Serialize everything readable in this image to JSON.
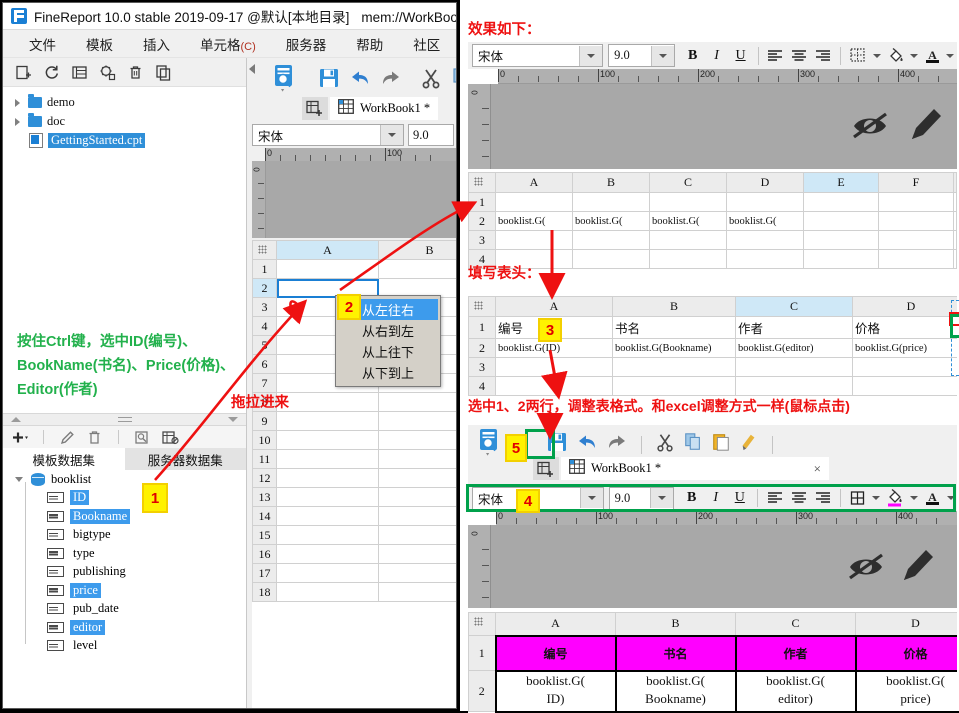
{
  "window": {
    "title": "FineReport 10.0 stable 2019-09-17 @默认[本地目录]",
    "title2": "mem://WorkBoo",
    "logo_icon": "finereport-logo-icon"
  },
  "menu": {
    "items": [
      {
        "label": "文件"
      },
      {
        "label": "模板"
      },
      {
        "label": "插入"
      },
      {
        "label": "单元格",
        "accel": "(C)"
      },
      {
        "label": "服务器"
      },
      {
        "label": "帮助"
      },
      {
        "label": "社区"
      }
    ]
  },
  "tree_toolbar": {
    "icons": [
      "new-template-icon",
      "refresh-icon",
      "rename-icon",
      "settings-icon",
      "delete-icon",
      "copy-icon"
    ]
  },
  "file_tree": {
    "items": [
      {
        "label": "demo",
        "type": "folder"
      },
      {
        "label": "doc",
        "type": "folder"
      },
      {
        "label": "GettingStarted.cpt",
        "type": "file",
        "selected": true
      }
    ]
  },
  "annotations": {
    "green_note_1": [
      "按住Ctrl键，选中ID(编号)、",
      "BookName(书名)、Price(价格)、",
      "Editor(作者)"
    ],
    "drag_in": "拖拉进来",
    "effect_title": "效果如下：",
    "fill_header_title": "填写表头：",
    "adjust_rows": "选中1、2两行，调整表格式。和excel调整方式一样(鼠标点击)"
  },
  "dataset_toolbar": {
    "icons": [
      "add-icon",
      "edit-icon",
      "delete-icon",
      "preview-icon",
      "dataset-config-icon"
    ]
  },
  "dataset_tabs": [
    {
      "label": "模板数据集",
      "active": true
    },
    {
      "label": "服务器数据集",
      "active": false
    }
  ],
  "dataset_tree": {
    "root": "booklist",
    "fields": [
      {
        "label": "ID",
        "selected": true
      },
      {
        "label": "Bookname",
        "selected": true
      },
      {
        "label": "bigtype",
        "selected": false
      },
      {
        "label": "type",
        "selected": false
      },
      {
        "label": "publishing",
        "selected": false
      },
      {
        "label": "price",
        "selected": true
      },
      {
        "label": "pub_date",
        "selected": false
      },
      {
        "label": "editor",
        "selected": true
      },
      {
        "label": "level",
        "selected": false
      }
    ]
  },
  "workbook": {
    "tab_label": "WorkBook1 *",
    "close_label": "×",
    "toolbar_icons": [
      "template-preview-icon",
      "save-icon",
      "undo-icon",
      "redo-icon",
      "cut-icon",
      "copy-icon",
      "paste-icon",
      "format-painter-icon"
    ],
    "tab_icons": [
      "new-sheet-icon",
      "workbook-icon"
    ]
  },
  "format_bar": {
    "font_name": "宋体",
    "font_size": "9.0",
    "bold": "B",
    "italic": "I",
    "underline": "U",
    "align_left_icon": "align-left-icon",
    "align_center_icon": "align-center-icon",
    "align_right_icon": "align-right-icon",
    "border_icon": "border-icon",
    "fill_color_icon": "fill-color-icon",
    "font_color_icon": "font-color-icon",
    "dropdown_icon": "chevron-down-icon"
  },
  "ruler": {
    "labels": [
      "0",
      "100",
      "200",
      "300",
      "400"
    ]
  },
  "left_grid": {
    "columns": [
      "A",
      "B"
    ],
    "selected_column": "A",
    "rows": [
      "1",
      "2",
      "3",
      "4",
      "5",
      "6",
      "7",
      "8",
      "9",
      "10",
      "11",
      "12",
      "13",
      "14",
      "15",
      "16",
      "17",
      "18"
    ],
    "selected_cell": "A2"
  },
  "context_menu": {
    "items": [
      {
        "label": "从左往右",
        "selected": true
      },
      {
        "label": "从右到左",
        "selected": false
      },
      {
        "label": "从上往下",
        "selected": false
      },
      {
        "label": "从下到上",
        "selected": false
      }
    ]
  },
  "grid_1": {
    "columns": [
      "A",
      "B",
      "C",
      "D",
      "E",
      "F"
    ],
    "selected_column": "E",
    "rows": [
      {
        "num": "1",
        "cells": [
          "",
          "",
          "",
          "",
          "",
          ""
        ]
      },
      {
        "num": "2",
        "cells": [
          "booklist.G(",
          "booklist.G(",
          "booklist.G(",
          "booklist.G(",
          "",
          ""
        ]
      },
      {
        "num": "3",
        "cells": [
          "",
          "",
          "",
          "",
          "",
          ""
        ]
      },
      {
        "num": "4",
        "cells": [
          "",
          "",
          "",
          "",
          "",
          ""
        ]
      }
    ]
  },
  "grid_2": {
    "columns": [
      "A",
      "B",
      "C",
      "D"
    ],
    "selected_column": "C",
    "rows": [
      {
        "num": "1",
        "cells": [
          "编号",
          "书名",
          "作者",
          "价格"
        ]
      },
      {
        "num": "2",
        "cells": [
          "booklist.G(ID)",
          "booklist.G(Bookname)",
          "booklist.G(editor)",
          "booklist.G(price)"
        ]
      },
      {
        "num": "3",
        "cells": [
          "",
          "",
          "",
          ""
        ]
      },
      {
        "num": "4",
        "cells": [
          "",
          "",
          "",
          ""
        ]
      }
    ]
  },
  "grid_3": {
    "columns": [
      "A",
      "B",
      "C",
      "D"
    ],
    "rows": [
      {
        "num": "1",
        "cells": [
          "编号",
          "书名",
          "作者",
          "价格"
        ],
        "style": "magenta-header"
      },
      {
        "num": "2",
        "cells": [
          "booklist.G(\nID)",
          "booklist.G(\nBookname)",
          "booklist.G(\neditor)",
          "booklist.G(\nprice)"
        ],
        "style": "formula"
      }
    ]
  },
  "badges": [
    {
      "num": "1"
    },
    {
      "num": "2"
    },
    {
      "num": "3"
    },
    {
      "num": "4"
    },
    {
      "num": "5"
    }
  ],
  "colors": {
    "accent_blue": "#2f8fd8",
    "annotation_green": "#22b14c",
    "annotation_red": "#ee1111",
    "badge_yellow": "#fff200",
    "magenta": "#ff00ff",
    "highlight_select": "#3d9bec"
  },
  "preview_icons": [
    "eye-off-icon",
    "pencil-icon"
  ]
}
